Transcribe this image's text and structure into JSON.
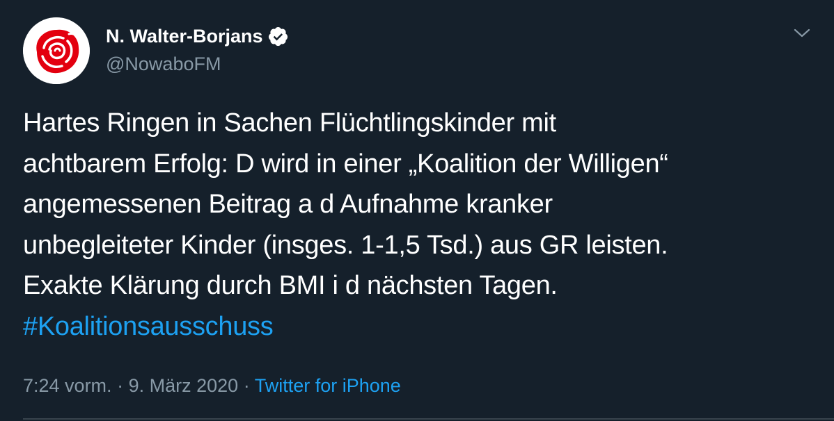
{
  "user": {
    "display_name": "N. Walter-Borjans",
    "handle": "@NowaboFM",
    "verified": true,
    "avatar_icon": "spd-rose-icon"
  },
  "tweet": {
    "lines": [
      "Hartes Ringen in Sachen Flüchtlingskinder mit",
      "achtbarem Erfolg: D wird in einer „Koalition der Willigen“",
      "angemessenen Beitrag a d Aufnahme kranker",
      "unbegleiteter Kinder (insges. 1-1,5 Tsd.) aus GR leisten.",
      "Exakte Klärung durch BMI i d nächsten Tagen."
    ],
    "hashtag": "#Koalitionsausschuss"
  },
  "meta": {
    "time": "7:24 vorm.",
    "separator": "·",
    "date": "9. März 2020",
    "source": "Twitter for iPhone"
  },
  "colors": {
    "background": "#15202b",
    "primary_text": "#ffffff",
    "secondary_text": "#8899a6",
    "accent": "#1da1f2",
    "rose": "#e3000f"
  },
  "icons": {
    "verified": "verified-badge-icon",
    "menu": "chevron-down-icon"
  }
}
